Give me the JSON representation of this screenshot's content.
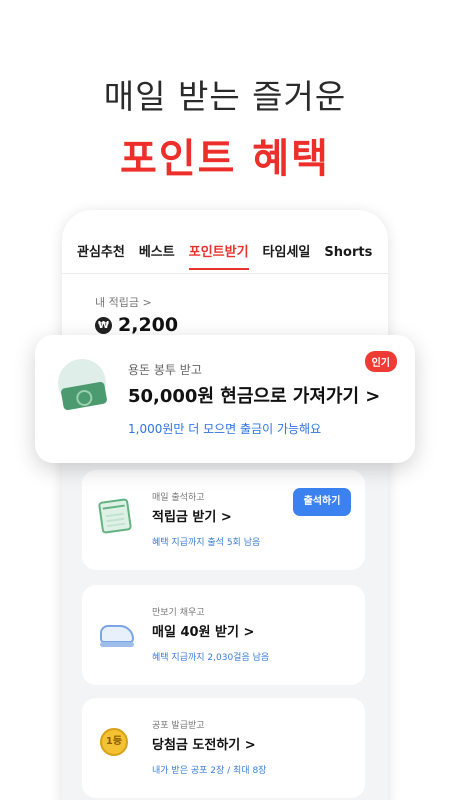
{
  "hero": {
    "subtitle": "매일 받는 즐거운",
    "title": "포인트 혜택"
  },
  "tabs": [
    "관심추천",
    "베스트",
    "포인트받기",
    "타임세일",
    "Shorts"
  ],
  "active_tab": "포인트받기",
  "points": {
    "label": "내 적립금 >",
    "currency_symbol": "₩",
    "value": "2,200"
  },
  "popup": {
    "subtitle": "용돈 봉투 받고",
    "title": "50,000원 현금으로 가져가기 >",
    "note": "1,000원만 더 모으면 출금이 가능해요",
    "badge": "인기"
  },
  "cards": [
    {
      "subtitle": "매일 출석하고",
      "title": "적립금 받기 >",
      "note": "혜택 지급까지 출석 5회 남음",
      "button": "출석하기",
      "icon": "calendar-icon"
    },
    {
      "subtitle": "만보기 채우고",
      "title": "매일 40원 받기 >",
      "note": "혜택 지급까지 2,030걸음 남음",
      "icon": "sneaker-icon"
    },
    {
      "subtitle": "공포 발급받고",
      "title": "당첨금 도전하기 >",
      "note": "내가 받은 공포 2장 / 최대 8장",
      "coin_text": "1등",
      "icon": "coin-icon"
    }
  ],
  "colors": {
    "accent_red": "#ec2f2b",
    "accent_blue": "#3b82f0"
  }
}
